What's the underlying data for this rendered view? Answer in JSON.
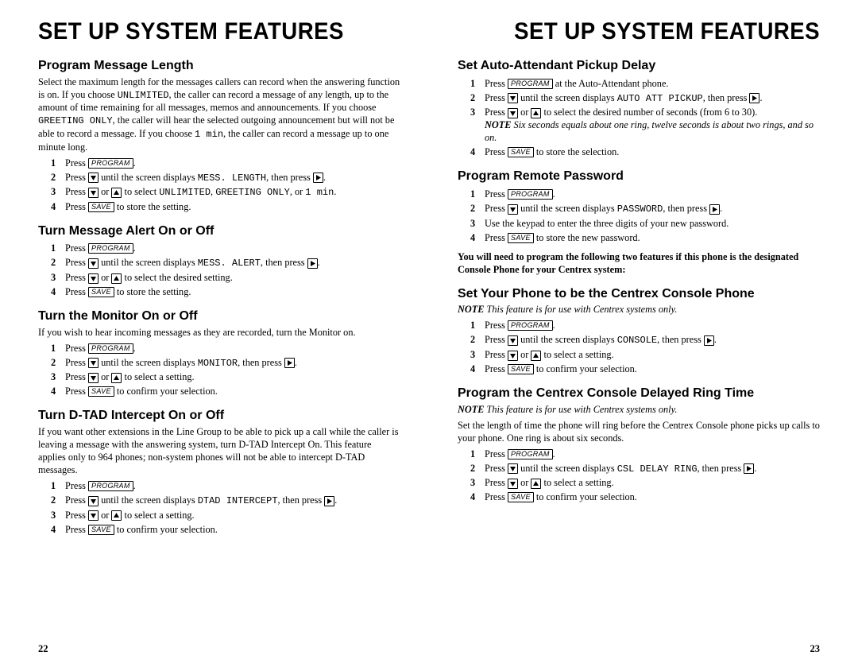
{
  "left": {
    "title": "Set Up System Features",
    "pagenum": "22",
    "s1": {
      "heading": "Program Message Length",
      "intro_pre": "Select the maximum length for the messages callers can record when the answering function is on.  If you choose ",
      "intro_unlimited": "UNLIMITED",
      "intro_mid1": ", the caller can record a message of any length, up to the amount of time remaining for all messages, memos and announcements.  If you choose ",
      "intro_greeting": "GREETING ONLY",
      "intro_mid2": ", the caller will hear the selected outgoing announcement but will not be able to record a message.  If you choose ",
      "intro_min": "1 min",
      "intro_post": ", the caller can record a message up to one minute long.",
      "step1_pre": "Press ",
      "step1_key": "PROGRAM",
      "step1_post": ".",
      "step2_pre": "Press ",
      "step2_mid": " until the screen displays ",
      "step2_disp": "MESS. LENGTH",
      "step2_post": ", then press ",
      "step3_pre": "Press ",
      "step3_or": " or ",
      "step3_mid": " to select ",
      "step3_u": "UNLIMITED",
      "step3_c": ", ",
      "step3_g": "GREETING ONLY",
      "step3_c2": ", or ",
      "step3_m": "1 min",
      "step3_post": ".",
      "step4_pre": "Press ",
      "step4_key": "SAVE",
      "step4_post": " to store the setting."
    },
    "s2": {
      "heading": "Turn Message Alert On or Off",
      "step1_pre": "Press ",
      "step1_key": "PROGRAM",
      "step1_post": ".",
      "step2_pre": "Press ",
      "step2_mid": " until the screen displays ",
      "step2_disp": "MESS. ALERT",
      "step2_post": ", then press ",
      "step3_pre": "Press ",
      "step3_or": " or ",
      "step3_post": " to select the desired setting.",
      "step4_pre": "Press ",
      "step4_key": "SAVE",
      "step4_post": " to store the setting."
    },
    "s3": {
      "heading": "Turn the Monitor On or Off",
      "intro": "If you wish to hear incoming messages as they are recorded, turn the Monitor on.",
      "step1_pre": "Press ",
      "step1_key": "PROGRAM",
      "step1_post": ".",
      "step2_pre": "Press ",
      "step2_mid": " until the screen displays ",
      "step2_disp": "MONITOR",
      "step2_post": ", then press ",
      "step3_pre": "Press ",
      "step3_or": " or ",
      "step3_post": " to select a setting.",
      "step4_pre": "Press ",
      "step4_key": "SAVE",
      "step4_post": " to confirm your selection."
    },
    "s4": {
      "heading": "Turn D-TAD Intercept On or Off",
      "intro": "If you want other extensions in the Line Group to be able to pick up a call while the caller is leaving a message with the answering system, turn D-TAD Intercept On.  This feature applies only to 964 phones; non-system phones will not be able to intercept D-TAD messages.",
      "step1_pre": "Press ",
      "step1_key": "PROGRAM",
      "step1_post": ".",
      "step2_pre": "Press ",
      "step2_mid": " until the screen displays ",
      "step2_disp": "DTAD INTERCEPT",
      "step2_post": ", then press ",
      "step3_pre": "Press ",
      "step3_or": " or ",
      "step3_post": " to select a setting.",
      "step4_pre": "Press ",
      "step4_key": "SAVE",
      "step4_post": " to confirm your selection."
    }
  },
  "right": {
    "title": "Set Up System Features",
    "pagenum": "23",
    "s1": {
      "heading": "Set Auto-Attendant Pickup Delay",
      "step1_pre": "Press ",
      "step1_key": "PROGRAM",
      "step1_post": " at the Auto-Attendant phone.",
      "step2_pre": "Press ",
      "step2_mid": " until the screen displays ",
      "step2_disp": "AUTO ATT PICKUP",
      "step2_post": ", then press ",
      "step3_pre": "Press ",
      "step3_or": " or ",
      "step3_post": " to select the desired number of seconds (from 6 to 30).",
      "note_label": "NOTE",
      "note_text": "   Six seconds equals about one ring, twelve seconds is about two rings, and so on.",
      "step4_pre": "Press ",
      "step4_key": "SAVE",
      "step4_post": " to store the selection."
    },
    "s2": {
      "heading": "Program Remote Password",
      "step1_pre": "Press ",
      "step1_key": "PROGRAM",
      "step1_post": ".",
      "step2_pre": "Press ",
      "step2_mid": " until the screen displays ",
      "step2_disp": "PASSWORD",
      "step2_post": ", then press ",
      "step3": "Use the keypad to enter the three digits of your new password.",
      "step4_pre": "Press ",
      "step4_key": "SAVE",
      "step4_post": " to store the new password."
    },
    "boldnote": "You will need to program the following two features if this phone is the designated Console Phone for your Centrex system:",
    "s3": {
      "heading": "Set Your Phone to be the Centrex Console Phone",
      "note_label": "NOTE",
      "note_text": "  This feature is for use with Centrex systems only.",
      "step1_pre": "Press ",
      "step1_key": "PROGRAM",
      "step1_post": ".",
      "step2_pre": "Press ",
      "step2_mid": " until the screen displays ",
      "step2_disp": "CONSOLE",
      "step2_post": ", then press ",
      "step3_pre": "Press ",
      "step3_or": " or ",
      "step3_post": " to select a setting.",
      "step4_pre": "Press ",
      "step4_key": "SAVE",
      "step4_post": " to confirm your selection."
    },
    "s4": {
      "heading": "Program the Centrex Console Delayed Ring Time",
      "note_label": "NOTE",
      "note_text": "  This feature is for use with Centrex systems only.",
      "intro": "Set the length of time the phone will ring before the Centrex Console phone picks up calls to your phone.  One ring is about six seconds.",
      "step1_pre": "Press ",
      "step1_key": "PROGRAM",
      "step1_post": ".",
      "step2_pre": "Press ",
      "step2_mid": " until the screen displays ",
      "step2_disp": "CSL DELAY RING",
      "step2_post": ", then press ",
      "step3_pre": "Press ",
      "step3_or": " or ",
      "step3_post": " to select a setting.",
      "step4_pre": "Press ",
      "step4_key": "SAVE",
      "step4_post": " to confirm your selection."
    }
  }
}
